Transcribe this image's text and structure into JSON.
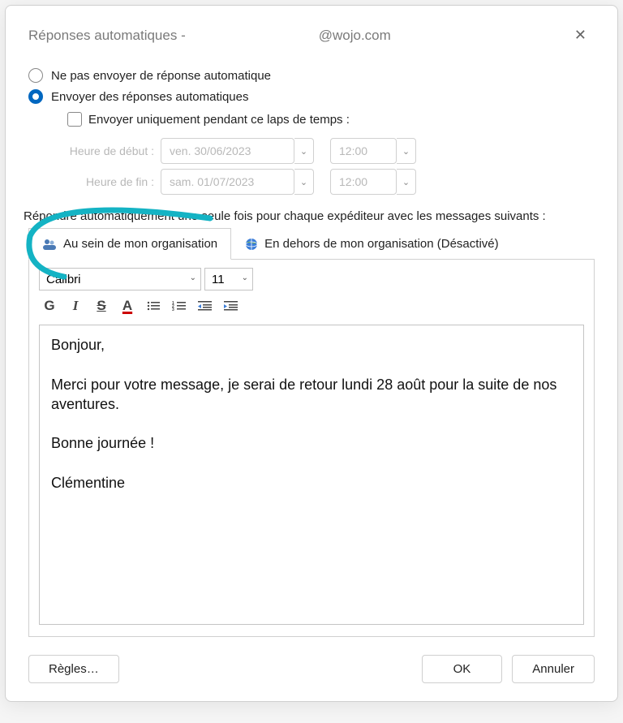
{
  "window": {
    "title_prefix": "Réponses automatiques - ",
    "title_suffix": "@wojo.com"
  },
  "radios": {
    "dont_send": "Ne pas envoyer de réponse automatique",
    "send": "Envoyer des réponses automatiques"
  },
  "checkbox": {
    "only_during": "Envoyer uniquement pendant ce laps de temps :"
  },
  "time": {
    "start_label": "Heure de début :",
    "end_label": "Heure de fin :",
    "start_date": "ven. 30/06/2023",
    "end_date": "sam. 01/07/2023",
    "start_time": "12:00",
    "end_time": "12:00"
  },
  "section_label": "Répondre automatiquement une seule fois pour chaque expéditeur avec les messages suivants :",
  "tabs": {
    "inside": "Au sein de mon organisation",
    "outside": "En dehors de mon organisation (Désactivé)"
  },
  "editor": {
    "font": "Calibri",
    "size": "11"
  },
  "message": "Bonjour,\n\nMerci pour votre message, je serai de retour lundi 28 août pour la suite de nos aventures.\n\nBonne journée !\n\nClémentine",
  "buttons": {
    "rules": "Règles…",
    "ok": "OK",
    "cancel": "Annuler"
  }
}
